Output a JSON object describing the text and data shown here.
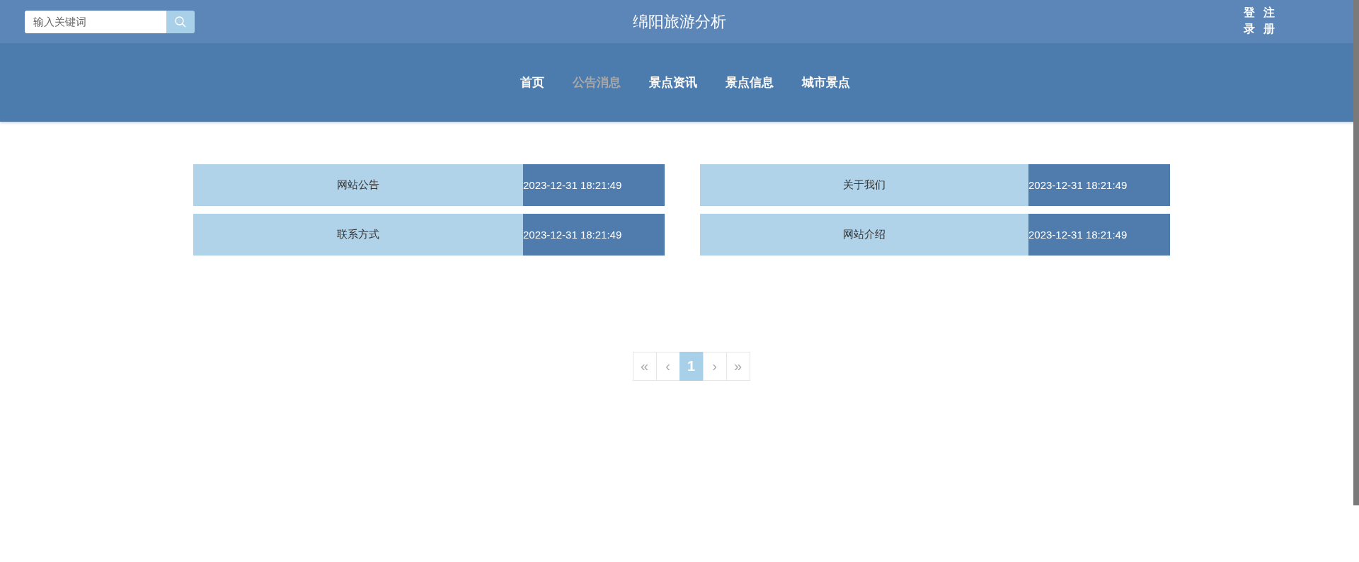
{
  "search": {
    "placeholder": "输入关键词"
  },
  "site_title": "绵阳旅游分析",
  "auth_links": [
    {
      "label": "登录"
    },
    {
      "label": "注册"
    }
  ],
  "nav": [
    {
      "label": "首页",
      "selected": false
    },
    {
      "label": "公告消息",
      "selected": true
    },
    {
      "label": "景点资讯",
      "selected": false
    },
    {
      "label": "景点信息",
      "selected": false
    },
    {
      "label": "城市景点",
      "selected": false
    }
  ],
  "notices": [
    {
      "title": "网站公告",
      "time": "2023-12-31 18:21:49"
    },
    {
      "title": "关于我们",
      "time": "2023-12-31 18:21:49"
    },
    {
      "title": "联系方式",
      "time": "2023-12-31 18:21:49"
    },
    {
      "title": "网站介绍",
      "time": "2023-12-31 18:21:49"
    }
  ],
  "pagination": [
    {
      "label": "«",
      "selected": false
    },
    {
      "label": "‹",
      "selected": false
    },
    {
      "label": "1",
      "selected": true
    },
    {
      "label": "›",
      "selected": false
    },
    {
      "label": "»",
      "selected": false
    }
  ]
}
